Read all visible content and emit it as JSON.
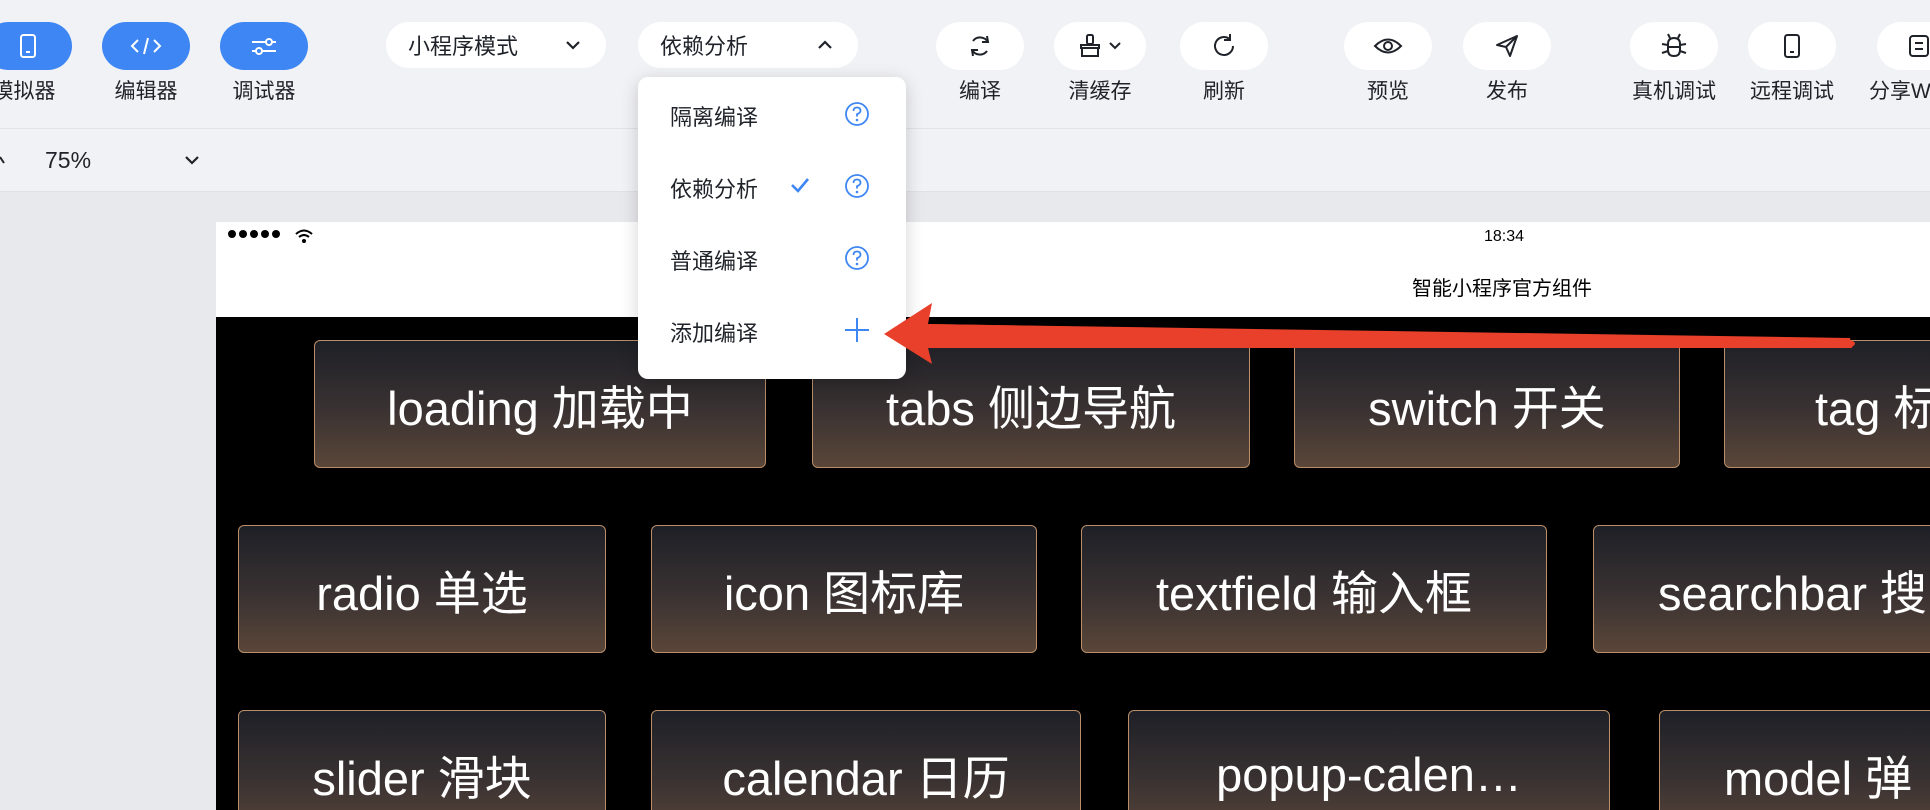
{
  "toolbar": {
    "left_buttons": [
      {
        "label": "模拟器",
        "icon": "phone-icon"
      },
      {
        "label": "编辑器",
        "icon": "code-icon"
      },
      {
        "label": "调试器",
        "icon": "sliders-icon"
      }
    ],
    "mode_select": {
      "value": "小程序模式"
    },
    "compile_select": {
      "value": "依赖分析"
    },
    "right_buttons": [
      {
        "label": "编译",
        "icon": "refresh-cycle-icon"
      },
      {
        "label": "清缓存",
        "icon": "brush-icon"
      },
      {
        "label": "刷新",
        "icon": "reload-icon"
      },
      {
        "label": "预览",
        "icon": "eye-icon"
      },
      {
        "label": "发布",
        "icon": "send-icon"
      },
      {
        "label": "真机调试",
        "icon": "bug-icon"
      },
      {
        "label": "远程调试",
        "icon": "mobile-icon"
      },
      {
        "label": "分享W",
        "icon": "share-icon"
      }
    ],
    "accent_color": "#3d86f4"
  },
  "zoom": {
    "value": "75%"
  },
  "compile_menu": {
    "items": [
      {
        "label": "隔离编译",
        "checked": false,
        "action": "help"
      },
      {
        "label": "依赖分析",
        "checked": true,
        "action": "help"
      },
      {
        "label": "普通编译",
        "checked": false,
        "action": "help"
      },
      {
        "label": "添加编译",
        "checked": false,
        "action": "add"
      }
    ]
  },
  "simulator": {
    "time": "18:34",
    "nav_title": "智能小程序官方组件",
    "components": [
      "loading 加载中",
      "tabs 侧边导航",
      "switch 开关",
      "tag 标",
      "radio 单选",
      "icon 图标库",
      "textfield 输入框",
      "searchbar 搜",
      "slider 滑块",
      "calendar 日历",
      "popup-calen…",
      "model 弹"
    ]
  },
  "annotation": {
    "arrow_color": "#e8402a"
  }
}
